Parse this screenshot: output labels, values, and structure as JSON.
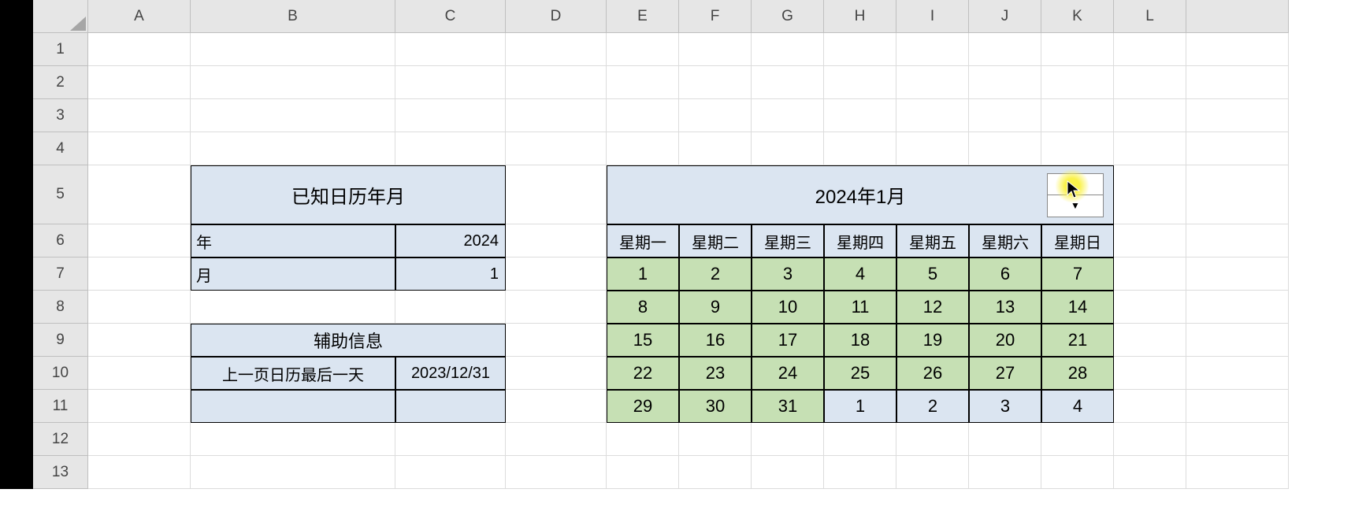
{
  "columns": [
    "A",
    "B",
    "C",
    "D",
    "E",
    "F",
    "G",
    "H",
    "I",
    "J",
    "K",
    "L"
  ],
  "rows": [
    "1",
    "2",
    "3",
    "4",
    "5",
    "6",
    "7",
    "8",
    "9",
    "10",
    "11",
    "12",
    "13"
  ],
  "left": {
    "title1": "已知日历年月",
    "year_label": "年",
    "year_value": "2024",
    "month_label": "月",
    "month_value": "1",
    "title2": "辅助信息",
    "aux_label": "上一页日历最后一天",
    "aux_value": "2023/12/31"
  },
  "calendar": {
    "title": "2024年1月",
    "weekdays": [
      "星期一",
      "星期二",
      "星期三",
      "星期四",
      "星期五",
      "星期六",
      "星期日"
    ],
    "grid": [
      {
        "v": "1",
        "c": "g"
      },
      {
        "v": "2",
        "c": "g"
      },
      {
        "v": "3",
        "c": "g"
      },
      {
        "v": "4",
        "c": "g"
      },
      {
        "v": "5",
        "c": "g"
      },
      {
        "v": "6",
        "c": "g"
      },
      {
        "v": "7",
        "c": "g"
      },
      {
        "v": "8",
        "c": "g"
      },
      {
        "v": "9",
        "c": "g"
      },
      {
        "v": "10",
        "c": "g"
      },
      {
        "v": "11",
        "c": "g"
      },
      {
        "v": "12",
        "c": "g"
      },
      {
        "v": "13",
        "c": "g"
      },
      {
        "v": "14",
        "c": "g"
      },
      {
        "v": "15",
        "c": "g"
      },
      {
        "v": "16",
        "c": "g"
      },
      {
        "v": "17",
        "c": "g"
      },
      {
        "v": "18",
        "c": "g"
      },
      {
        "v": "19",
        "c": "g"
      },
      {
        "v": "20",
        "c": "g"
      },
      {
        "v": "21",
        "c": "g"
      },
      {
        "v": "22",
        "c": "g"
      },
      {
        "v": "23",
        "c": "g"
      },
      {
        "v": "24",
        "c": "g"
      },
      {
        "v": "25",
        "c": "g"
      },
      {
        "v": "26",
        "c": "g"
      },
      {
        "v": "27",
        "c": "g"
      },
      {
        "v": "28",
        "c": "g"
      },
      {
        "v": "29",
        "c": "g"
      },
      {
        "v": "30",
        "c": "g"
      },
      {
        "v": "31",
        "c": "g"
      },
      {
        "v": "1",
        "c": "b"
      },
      {
        "v": "2",
        "c": "b"
      },
      {
        "v": "3",
        "c": "b"
      },
      {
        "v": "4",
        "c": "b"
      }
    ]
  }
}
